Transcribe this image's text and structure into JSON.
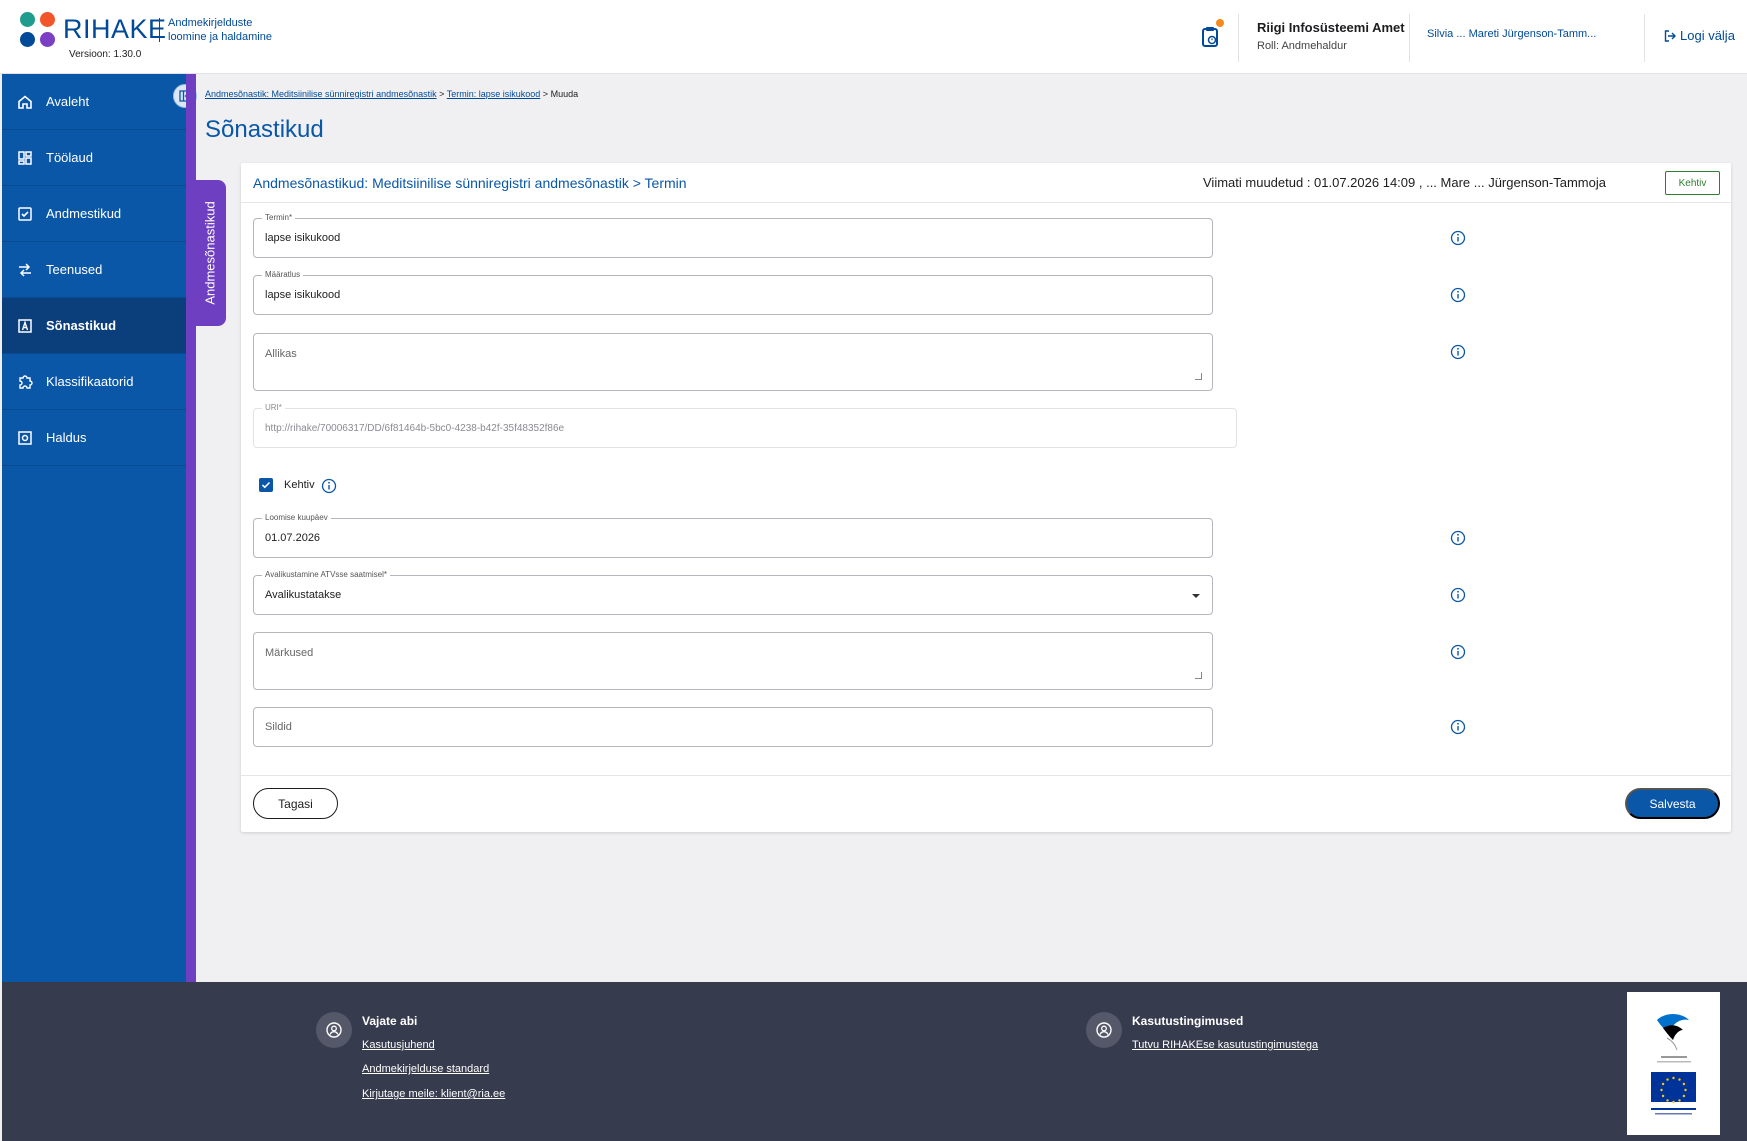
{
  "header": {
    "logo_text": "RIHAKE",
    "logo_sub_line1": "Andmekirjelduste",
    "logo_sub_line2": "loomine ja haldamine",
    "version": "Versioon: 1.30.0",
    "org_name": "Riigi Infosüsteemi Amet",
    "org_role": "Roll: Andmehaldur",
    "user_text": "Silvia ... Mareti Jürgenson-Tamm...",
    "logout_label": "Logi välja"
  },
  "sidebar": {
    "items": [
      {
        "label": "Avaleht",
        "icon": "home-icon"
      },
      {
        "label": "Töölaud",
        "icon": "dashboard-icon"
      },
      {
        "label": "Andmestikud",
        "icon": "checkbox-icon"
      },
      {
        "label": "Teenused",
        "icon": "swap-icon"
      },
      {
        "label": "Sõnastikud",
        "icon": "dictionary-icon"
      },
      {
        "label": "Klassifikaatorid",
        "icon": "puzzle-icon"
      },
      {
        "label": "Haldus",
        "icon": "settings-icon"
      }
    ],
    "active_index": 4,
    "vertical_tab": "Andmesõnastikud"
  },
  "breadcrumb": {
    "link1": "Andmesõnastik: Meditsiinilise sünniregistri andmesõnastik",
    "link2": "Termin: lapse isikukood",
    "current": "Muuda",
    "separator": ">"
  },
  "page_title": "Sõnastikud",
  "card": {
    "title": "Andmesõnastikud: Meditsiinilise sünniregistri andmesõnastik > Termin",
    "modified": "Viimati muudetud : 01.07.2026 14:09 ,  ... Mare ... Jürgenson-Tammoja",
    "status": "Kehtiv",
    "fields": {
      "termin": {
        "label": "Termin*",
        "value": "lapse isikukood"
      },
      "maaratlus": {
        "label": "Määratlus",
        "value": "lapse isikukood"
      },
      "allikas": {
        "placeholder": "Allikas"
      },
      "uri": {
        "label": "URI*",
        "value": "http://rihake/70006317/DD/6f81464b-5bc0-4238-b42f-35f48352f86e"
      },
      "kehtiv": {
        "label": "Kehtiv",
        "checked": true
      },
      "loomise_kuupaev": {
        "label": "Loomise kuupäev",
        "value": "01.07.2026"
      },
      "avalikustamine": {
        "label": "Avalikustamine ATVsse saatmisel*",
        "value": "Avalikustatakse"
      },
      "markused": {
        "placeholder": "Märkused"
      },
      "sildid": {
        "placeholder": "Sildid"
      }
    },
    "back_label": "Tagasi",
    "save_label": "Salvesta"
  },
  "footer": {
    "help_title": "Vajate abi",
    "help_links": [
      "Kasutusjuhend",
      "Andmekirjelduse standard",
      "Kirjutage meile: klient@ria.ee"
    ],
    "terms_title": "Kasutustingimused",
    "terms_link": "Tutvu RIHAKEse kasutustingimustega"
  },
  "colors": {
    "primary": "#0a57a8",
    "sidebar_active": "#0b3f7c",
    "accent_purple": "#6e3fc0",
    "status_green": "#2e7d32",
    "footer_bg": "#373b4e"
  }
}
